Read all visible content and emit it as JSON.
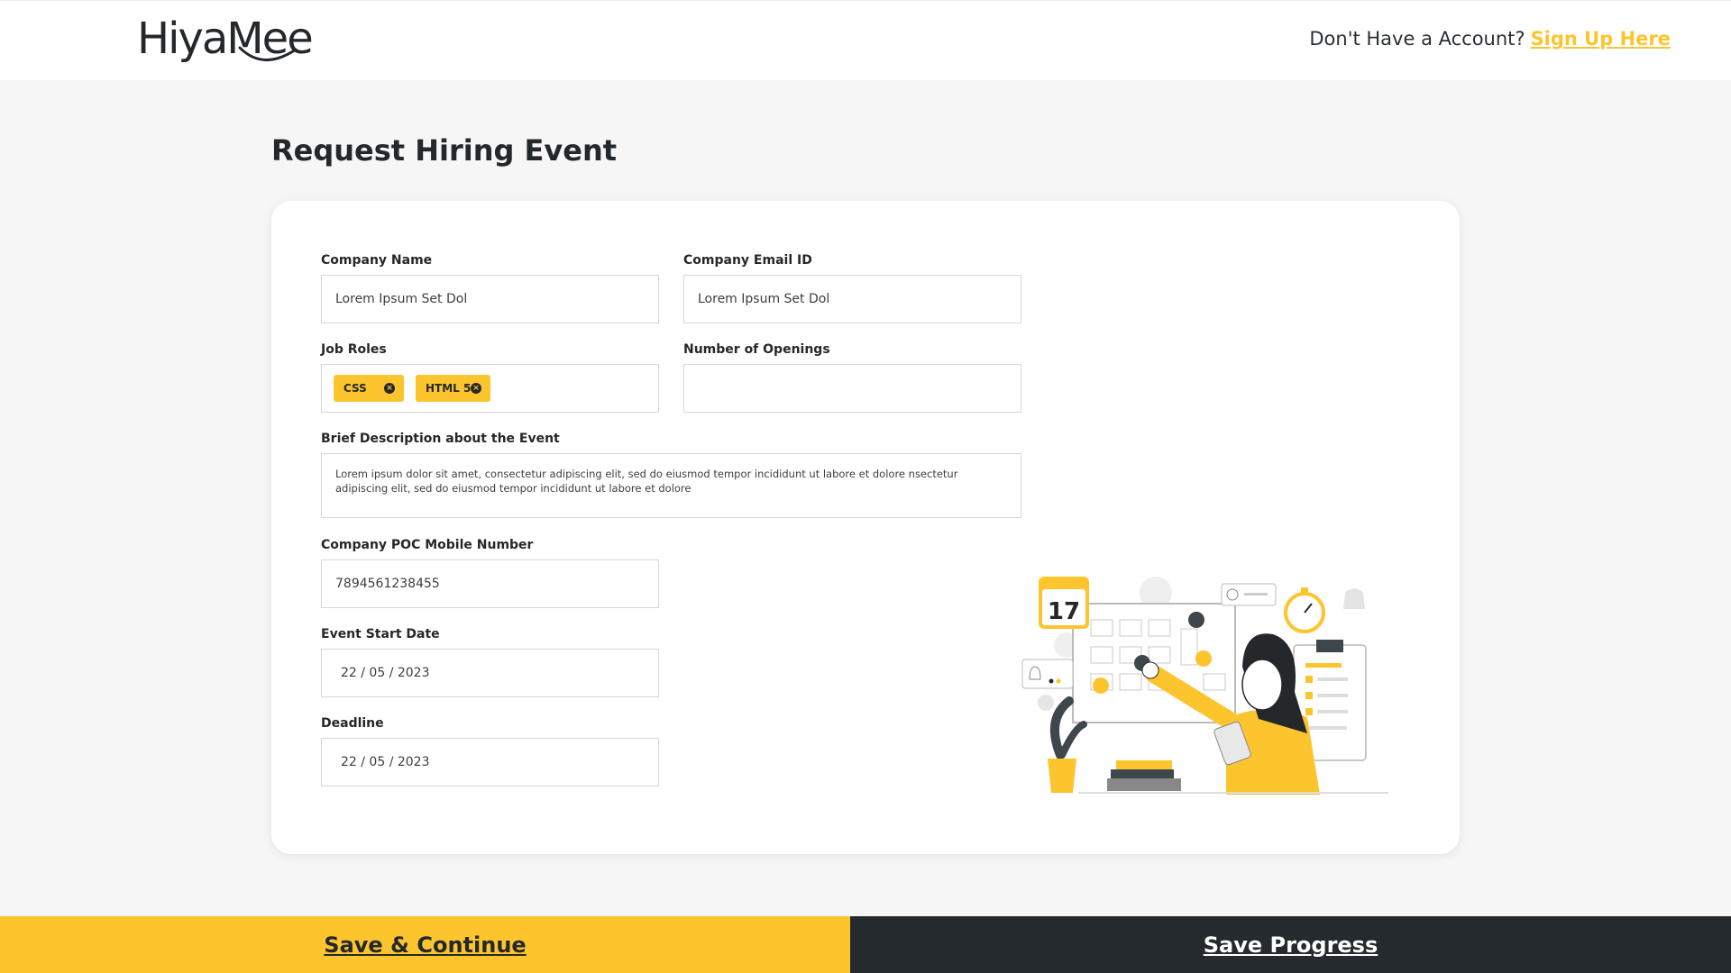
{
  "header": {
    "logo": "HiyaMee",
    "account_prompt": "Don't Have a Account?",
    "signup_link": "Sign Up Here"
  },
  "page": {
    "title": "Request Hiring Event"
  },
  "form": {
    "company_name": {
      "label": "Company Name",
      "value": "Lorem Ipsum Set Dol"
    },
    "company_email": {
      "label": "Company Email ID",
      "value": "Lorem Ipsum Set Dol"
    },
    "job_roles": {
      "label": "Job Roles",
      "chips": [
        "CSS",
        "HTML 5"
      ]
    },
    "openings": {
      "label": "Number of Openings",
      "value": ""
    },
    "description": {
      "label": "Brief Description about the Event",
      "value": "Lorem ipsum dolor sit amet, consectetur adipiscing elit, sed do eiusmod tempor incididunt ut labore et dolore nsectetur adipiscing elit, sed do eiusmod tempor incididunt ut labore et dolore"
    },
    "poc_mobile": {
      "label": "Company POC Mobile Number",
      "value": "7894561238455"
    },
    "start_date": {
      "label": "Event Start Date",
      "value": "22 / 05 / 2023"
    },
    "deadline": {
      "label": "Deadline",
      "value": "22 / 05 / 2023"
    }
  },
  "illustration": {
    "calendar_day": "17",
    "icon": "woman-with-calendar-board-illustration"
  },
  "footer": {
    "save_continue": "Save & Continue",
    "save_progress": "Save Progress"
  },
  "colors": {
    "accent": "#fcc52e",
    "dark": "#242a2d",
    "background": "#f6f6f6"
  }
}
